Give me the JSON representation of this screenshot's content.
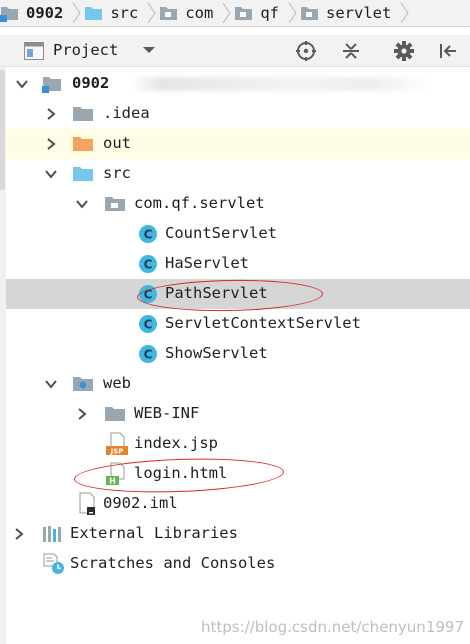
{
  "breadcrumb": [
    {
      "label": "0902",
      "icon": "module-folder-icon",
      "bold": true
    },
    {
      "label": "src",
      "icon": "source-folder-icon",
      "bold": false
    },
    {
      "label": "com",
      "icon": "package-icon",
      "bold": false
    },
    {
      "label": "qf",
      "icon": "package-icon",
      "bold": false
    },
    {
      "label": "servlet",
      "icon": "package-icon",
      "bold": false
    }
  ],
  "toolwindow": {
    "title": "Project",
    "actions": [
      "locate-icon",
      "collapse-all-icon",
      "gear-icon",
      "hide-icon"
    ]
  },
  "tree": {
    "root": {
      "label": "0902",
      "path_hint": "（…值子）"
    },
    "idea": {
      "label": ".idea"
    },
    "out": {
      "label": "out"
    },
    "src": {
      "label": "src"
    },
    "package": {
      "label": "com.qf.servlet"
    },
    "classes": [
      "CountServlet",
      "HaServlet",
      "PathServlet",
      "ServletContextServlet",
      "ShowServlet"
    ],
    "web": {
      "label": "web"
    },
    "web_inf": {
      "label": "WEB-INF"
    },
    "index": {
      "label": "index.jsp",
      "badge": "JSP"
    },
    "login": {
      "label": "login.html",
      "badge": "H"
    },
    "iml": {
      "label": "0902.iml"
    },
    "external": {
      "label": "External Libraries"
    },
    "scratches": {
      "label": "Scratches and Consoles"
    }
  },
  "selected_item": "PathServlet",
  "colors": {
    "folder_gray": "#9aa7b0",
    "folder_orange": "#f4a460",
    "source_blue": "#75c7ec",
    "class_blue": "#40b6e0",
    "highlight_red": "#d42828",
    "selection": "#d5d5d5"
  },
  "watermark": "https://blog.csdn.net/chenyun1997"
}
